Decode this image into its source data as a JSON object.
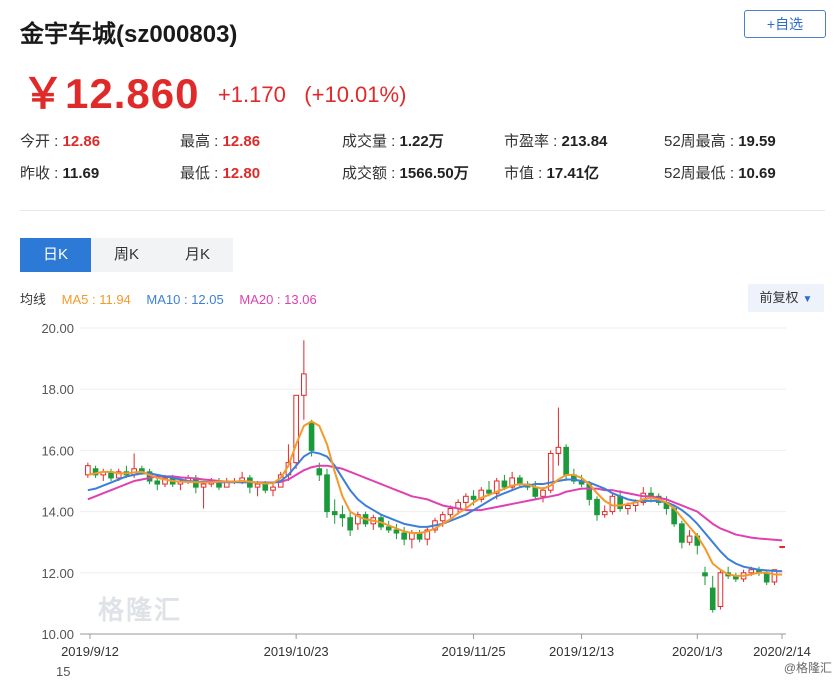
{
  "header": {
    "title": "金宇车城(sz000803)",
    "watch_label": "+自选"
  },
  "quote": {
    "price": "￥12.860",
    "change": "+1.170",
    "change_pct": "(+10.01%)"
  },
  "stats": [
    {
      "label": "今开 : ",
      "value": "12.86",
      "red": true
    },
    {
      "label": "最高 : ",
      "value": "12.86",
      "red": true
    },
    {
      "label": "成交量 : ",
      "value": "1.22万",
      "red": false
    },
    {
      "label": "市盈率 : ",
      "value": "213.84",
      "red": false
    },
    {
      "label": "52周最高 : ",
      "value": "19.59",
      "red": false
    },
    {
      "label": "昨收 : ",
      "value": "11.69",
      "red": false
    },
    {
      "label": "最低 : ",
      "value": "12.80",
      "red": true
    },
    {
      "label": "成交额 : ",
      "value": "1566.50万",
      "red": false
    },
    {
      "label": "市值 : ",
      "value": "17.41亿",
      "red": false
    },
    {
      "label": "52周最低 : ",
      "value": "10.69",
      "red": false
    }
  ],
  "tabs": [
    {
      "label": "日K",
      "active": true
    },
    {
      "label": "周K",
      "active": false
    },
    {
      "label": "月K",
      "active": false
    }
  ],
  "ma": {
    "label": "均线",
    "ma5": "MA5 : 11.94",
    "ma10": "MA10 : 12.05",
    "ma20": "MA20 : 13.06"
  },
  "adjust": {
    "label": "前复权",
    "icon": "caret-down-icon"
  },
  "colors": {
    "up": "#e02a2a",
    "down": "#1a9a3a",
    "ma5": "#f39a2b",
    "ma10": "#3c7fd8",
    "ma20": "#e040b0",
    "accent": "#2d7ad6"
  },
  "chart_data": {
    "type": "candlestick",
    "ylim": [
      10,
      20
    ],
    "yticks": [
      "20.00",
      "18.00",
      "16.00",
      "14.00",
      "12.00",
      "10.00"
    ],
    "xticks": [
      {
        "label": "2019/9/12",
        "index": 0
      },
      {
        "label": "2019/10/23",
        "index": 27
      },
      {
        "label": "2019/11/25",
        "index": 50
      },
      {
        "label": "2019/12/13",
        "index": 64
      },
      {
        "label": "2020/1/3",
        "index": 79
      },
      {
        "label": "2020/2/14",
        "index": 100
      }
    ],
    "candles": [
      [
        15.2,
        15.6,
        15.1,
        15.5
      ],
      [
        15.4,
        15.5,
        15.1,
        15.2
      ],
      [
        15.2,
        15.4,
        15.0,
        15.3
      ],
      [
        15.3,
        15.4,
        15.0,
        15.1
      ],
      [
        15.1,
        15.4,
        15.0,
        15.3
      ],
      [
        15.3,
        15.5,
        15.1,
        15.2
      ],
      [
        15.2,
        15.9,
        15.1,
        15.4
      ],
      [
        15.4,
        15.5,
        15.2,
        15.3
      ],
      [
        15.3,
        15.4,
        14.9,
        15.0
      ],
      [
        15.0,
        15.2,
        14.7,
        14.9
      ],
      [
        14.9,
        15.2,
        14.8,
        15.1
      ],
      [
        15.1,
        15.2,
        14.8,
        14.9
      ],
      [
        14.9,
        15.1,
        14.7,
        15.0
      ],
      [
        15.0,
        15.2,
        14.9,
        15.1
      ],
      [
        15.1,
        15.2,
        14.6,
        14.8
      ],
      [
        14.8,
        15.0,
        14.1,
        14.9
      ],
      [
        14.9,
        15.1,
        14.8,
        15.0
      ],
      [
        15.0,
        15.1,
        14.7,
        14.8
      ],
      [
        14.8,
        15.1,
        14.8,
        15.0
      ],
      [
        15.0,
        15.1,
        14.9,
        15.0
      ],
      [
        15.0,
        15.3,
        14.9,
        15.1
      ],
      [
        15.1,
        15.2,
        14.6,
        14.8
      ],
      [
        14.8,
        15.0,
        14.5,
        14.9
      ],
      [
        14.9,
        15.0,
        14.6,
        14.7
      ],
      [
        14.7,
        14.9,
        14.5,
        14.8
      ],
      [
        14.8,
        15.3,
        14.8,
        15.2
      ],
      [
        15.2,
        16.2,
        15.0,
        15.6
      ],
      [
        15.6,
        17.8,
        15.4,
        17.8
      ],
      [
        17.8,
        19.6,
        17.0,
        18.5
      ],
      [
        16.9,
        17.0,
        15.8,
        16.0
      ],
      [
        15.4,
        15.6,
        15.0,
        15.2
      ],
      [
        15.2,
        15.4,
        13.8,
        14.0
      ],
      [
        14.0,
        14.4,
        13.6,
        13.9
      ],
      [
        13.9,
        14.2,
        13.5,
        13.8
      ],
      [
        13.8,
        14.0,
        13.2,
        13.4
      ],
      [
        13.6,
        14.0,
        13.4,
        13.9
      ],
      [
        13.9,
        14.0,
        13.5,
        13.6
      ],
      [
        13.6,
        13.9,
        13.4,
        13.8
      ],
      [
        13.8,
        13.9,
        13.4,
        13.5
      ],
      [
        13.5,
        13.7,
        13.3,
        13.4
      ],
      [
        13.4,
        13.6,
        13.1,
        13.3
      ],
      [
        13.3,
        13.5,
        12.9,
        13.1
      ],
      [
        13.1,
        13.4,
        12.8,
        13.3
      ],
      [
        13.3,
        13.4,
        13.0,
        13.1
      ],
      [
        13.1,
        13.5,
        12.9,
        13.4
      ],
      [
        13.4,
        13.8,
        13.3,
        13.7
      ],
      [
        13.7,
        14.0,
        13.5,
        13.9
      ],
      [
        13.9,
        14.2,
        13.8,
        14.1
      ],
      [
        14.1,
        14.4,
        13.9,
        14.3
      ],
      [
        14.3,
        14.6,
        14.1,
        14.5
      ],
      [
        14.5,
        14.7,
        14.2,
        14.4
      ],
      [
        14.4,
        14.8,
        14.3,
        14.7
      ],
      [
        14.7,
        15.0,
        14.5,
        14.6
      ],
      [
        14.6,
        15.1,
        14.4,
        15.0
      ],
      [
        15.0,
        15.2,
        14.7,
        14.8
      ],
      [
        14.8,
        15.3,
        14.7,
        15.1
      ],
      [
        15.1,
        15.2,
        14.8,
        14.9
      ],
      [
        14.9,
        15.0,
        14.7,
        14.8
      ],
      [
        14.8,
        15.0,
        14.4,
        14.5
      ],
      [
        14.5,
        14.8,
        14.3,
        14.7
      ],
      [
        14.7,
        16.0,
        14.6,
        15.9
      ],
      [
        15.9,
        17.4,
        15.5,
        16.1
      ],
      [
        16.1,
        16.2,
        15.0,
        15.2
      ],
      [
        15.2,
        15.4,
        14.9,
        15.0
      ],
      [
        15.0,
        15.2,
        14.8,
        14.9
      ],
      [
        14.9,
        15.0,
        14.2,
        14.4
      ],
      [
        14.4,
        14.5,
        13.7,
        13.9
      ],
      [
        13.9,
        14.2,
        13.8,
        14.0
      ],
      [
        14.0,
        14.6,
        13.9,
        14.5
      ],
      [
        14.5,
        14.7,
        14.0,
        14.1
      ],
      [
        14.1,
        14.3,
        13.9,
        14.2
      ],
      [
        14.2,
        14.4,
        14.0,
        14.3
      ],
      [
        14.3,
        14.8,
        14.2,
        14.6
      ],
      [
        14.6,
        14.8,
        14.3,
        14.5
      ],
      [
        14.5,
        14.6,
        14.2,
        14.3
      ],
      [
        14.3,
        14.5,
        13.9,
        14.1
      ],
      [
        14.1,
        14.2,
        13.5,
        13.6
      ],
      [
        13.6,
        13.7,
        12.8,
        13.0
      ],
      [
        13.0,
        13.4,
        12.9,
        13.2
      ],
      [
        13.2,
        13.3,
        12.6,
        12.9
      ],
      [
        12.0,
        12.2,
        11.6,
        11.9
      ],
      [
        11.5,
        11.9,
        10.7,
        10.8
      ],
      [
        10.9,
        12.1,
        10.8,
        12.0
      ],
      [
        12.0,
        12.2,
        11.8,
        11.9
      ],
      [
        11.9,
        12.0,
        11.7,
        11.8
      ],
      [
        11.8,
        12.1,
        11.7,
        12.0
      ],
      [
        12.0,
        12.2,
        11.9,
        12.1
      ],
      [
        12.1,
        12.2,
        11.9,
        12.0
      ],
      [
        12.0,
        12.1,
        11.6,
        11.7
      ],
      [
        11.7,
        12.1,
        11.6,
        12.1
      ],
      [
        12.86,
        12.86,
        12.8,
        12.86
      ]
    ],
    "ma5": [
      15.2,
      15.25,
      15.3,
      15.3,
      15.25,
      15.25,
      15.28,
      15.3,
      15.2,
      15.1,
      15.05,
      15.0,
      14.98,
      14.97,
      14.96,
      14.95,
      14.96,
      14.98,
      14.98,
      14.98,
      15.0,
      14.98,
      14.94,
      14.92,
      14.93,
      15.1,
      15.5,
      16.2,
      16.8,
      16.95,
      16.8,
      16.2,
      15.3,
      14.5,
      14.0,
      13.85,
      13.75,
      13.7,
      13.65,
      13.55,
      13.45,
      13.35,
      13.3,
      13.3,
      13.35,
      13.45,
      13.6,
      13.75,
      13.95,
      14.1,
      14.3,
      14.45,
      14.55,
      14.65,
      14.75,
      14.85,
      14.9,
      14.88,
      14.8,
      14.75,
      14.85,
      15.05,
      15.2,
      15.2,
      15.1,
      14.9,
      14.6,
      14.35,
      14.2,
      14.2,
      14.25,
      14.3,
      14.4,
      14.45,
      14.4,
      14.3,
      14.1,
      13.8,
      13.5,
      13.2,
      12.8,
      12.3,
      12.1,
      11.95,
      11.9,
      11.9,
      11.95,
      12.0,
      12.0,
      11.95,
      11.94
    ],
    "ma10": [
      14.7,
      14.75,
      14.85,
      14.95,
      15.05,
      15.15,
      15.2,
      15.25,
      15.25,
      15.2,
      15.15,
      15.1,
      15.05,
      15.0,
      14.98,
      14.97,
      14.97,
      14.96,
      14.96,
      14.96,
      14.96,
      14.96,
      14.95,
      14.94,
      14.94,
      15.0,
      15.2,
      15.5,
      15.8,
      15.95,
      15.9,
      15.8,
      15.5,
      15.1,
      14.7,
      14.4,
      14.2,
      14.05,
      13.9,
      13.8,
      13.7,
      13.6,
      13.55,
      13.5,
      13.5,
      13.55,
      13.6,
      13.7,
      13.8,
      13.9,
      14.05,
      14.2,
      14.35,
      14.5,
      14.6,
      14.7,
      14.8,
      14.85,
      14.9,
      14.9,
      14.95,
      15.0,
      15.05,
      15.05,
      15.0,
      14.95,
      14.85,
      14.75,
      14.6,
      14.5,
      14.4,
      14.35,
      14.35,
      14.35,
      14.35,
      14.3,
      14.2,
      14.05,
      13.85,
      13.6,
      13.3,
      13.0,
      12.7,
      12.45,
      12.3,
      12.2,
      12.15,
      12.1,
      12.08,
      12.06,
      12.05
    ],
    "ma20": [
      14.4,
      14.5,
      14.6,
      14.7,
      14.8,
      14.9,
      15.0,
      15.05,
      15.1,
      15.15,
      15.15,
      15.15,
      15.12,
      15.1,
      15.08,
      15.05,
      15.03,
      15.0,
      14.98,
      14.97,
      14.96,
      14.96,
      14.95,
      14.95,
      14.95,
      14.97,
      15.05,
      15.2,
      15.35,
      15.45,
      15.5,
      15.5,
      15.45,
      15.4,
      15.3,
      15.2,
      15.1,
      15.0,
      14.9,
      14.8,
      14.7,
      14.6,
      14.5,
      14.45,
      14.4,
      14.3,
      14.2,
      14.15,
      14.1,
      14.05,
      14.05,
      14.05,
      14.1,
      14.15,
      14.2,
      14.25,
      14.3,
      14.35,
      14.4,
      14.45,
      14.5,
      14.55,
      14.65,
      14.7,
      14.75,
      14.75,
      14.75,
      14.7,
      14.7,
      14.65,
      14.6,
      14.55,
      14.5,
      14.5,
      14.45,
      14.4,
      14.3,
      14.2,
      14.1,
      14.0,
      13.8,
      13.6,
      13.45,
      13.35,
      13.25,
      13.2,
      13.15,
      13.12,
      13.1,
      13.08,
      13.06
    ]
  },
  "volume_axis_top": "15",
  "watermark": "格隆汇",
  "footer": "@格隆汇"
}
